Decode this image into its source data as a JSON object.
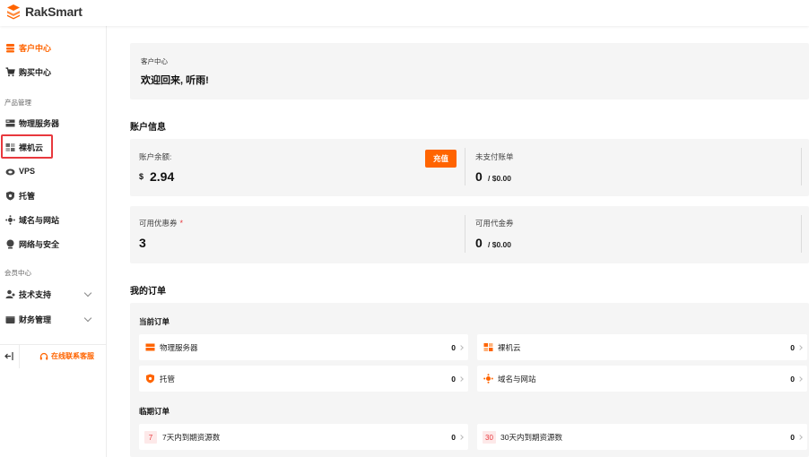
{
  "header": {
    "brand": "RakSmart"
  },
  "sidebar": {
    "items": [
      {
        "label": "客户中心",
        "icon": "database-icon",
        "active": true
      },
      {
        "label": "购买中心",
        "icon": "cart-icon"
      }
    ],
    "product_section": "产品管理",
    "products": [
      {
        "label": "物理服务器",
        "icon": "server-icon"
      },
      {
        "label": "裸机云",
        "icon": "bare-metal-icon"
      },
      {
        "label": "VPS",
        "icon": "vps-icon"
      },
      {
        "label": "托管",
        "icon": "shield-icon"
      },
      {
        "label": "域名与网站",
        "icon": "globe-icon"
      },
      {
        "label": "网络与安全",
        "icon": "network-icon"
      }
    ],
    "member_section": "会员中心",
    "member": [
      {
        "label": "技术支持",
        "icon": "support-icon"
      },
      {
        "label": "财务管理",
        "icon": "wallet-icon"
      }
    ],
    "footer": {
      "support_label": "在线联系客服"
    }
  },
  "welcome_card": {
    "breadcrumb": "客户中心",
    "greeting": "欢迎回来, 听雨!"
  },
  "account": {
    "title": "账户信息",
    "balance_label": "账户余额:",
    "currency": "$",
    "balance": "2.94",
    "recharge_label": "充值",
    "unpaid_label": "未支付账单",
    "unpaid_count": "0",
    "unpaid_amount": "/ $0.00",
    "coupon_label": "可用优惠券",
    "coupon_star": "*",
    "coupon_count": "3",
    "voucher_label": "可用代金券",
    "voucher_count": "0",
    "voucher_amount": "/ $0.00"
  },
  "orders": {
    "title": "我的订单",
    "current_title": "当前订单",
    "current": [
      {
        "label": "物理服务器",
        "count": "0",
        "icon": "server-icon"
      },
      {
        "label": "裸机云",
        "count": "0",
        "icon": "bare-metal-icon"
      },
      {
        "label": "托管",
        "count": "0",
        "icon": "shield-icon"
      },
      {
        "label": "域名与网站",
        "count": "0",
        "icon": "globe-icon"
      }
    ],
    "expiring_title": "临期订单",
    "expiring": [
      {
        "days": "7",
        "label": "7天内到期资源数",
        "count": "0"
      },
      {
        "days": "30",
        "label": "30天内到期资源数",
        "count": "0"
      }
    ]
  },
  "colors": {
    "accent": "#ff6400",
    "highlight": "#e8383d",
    "card": "#f5f5f5"
  }
}
